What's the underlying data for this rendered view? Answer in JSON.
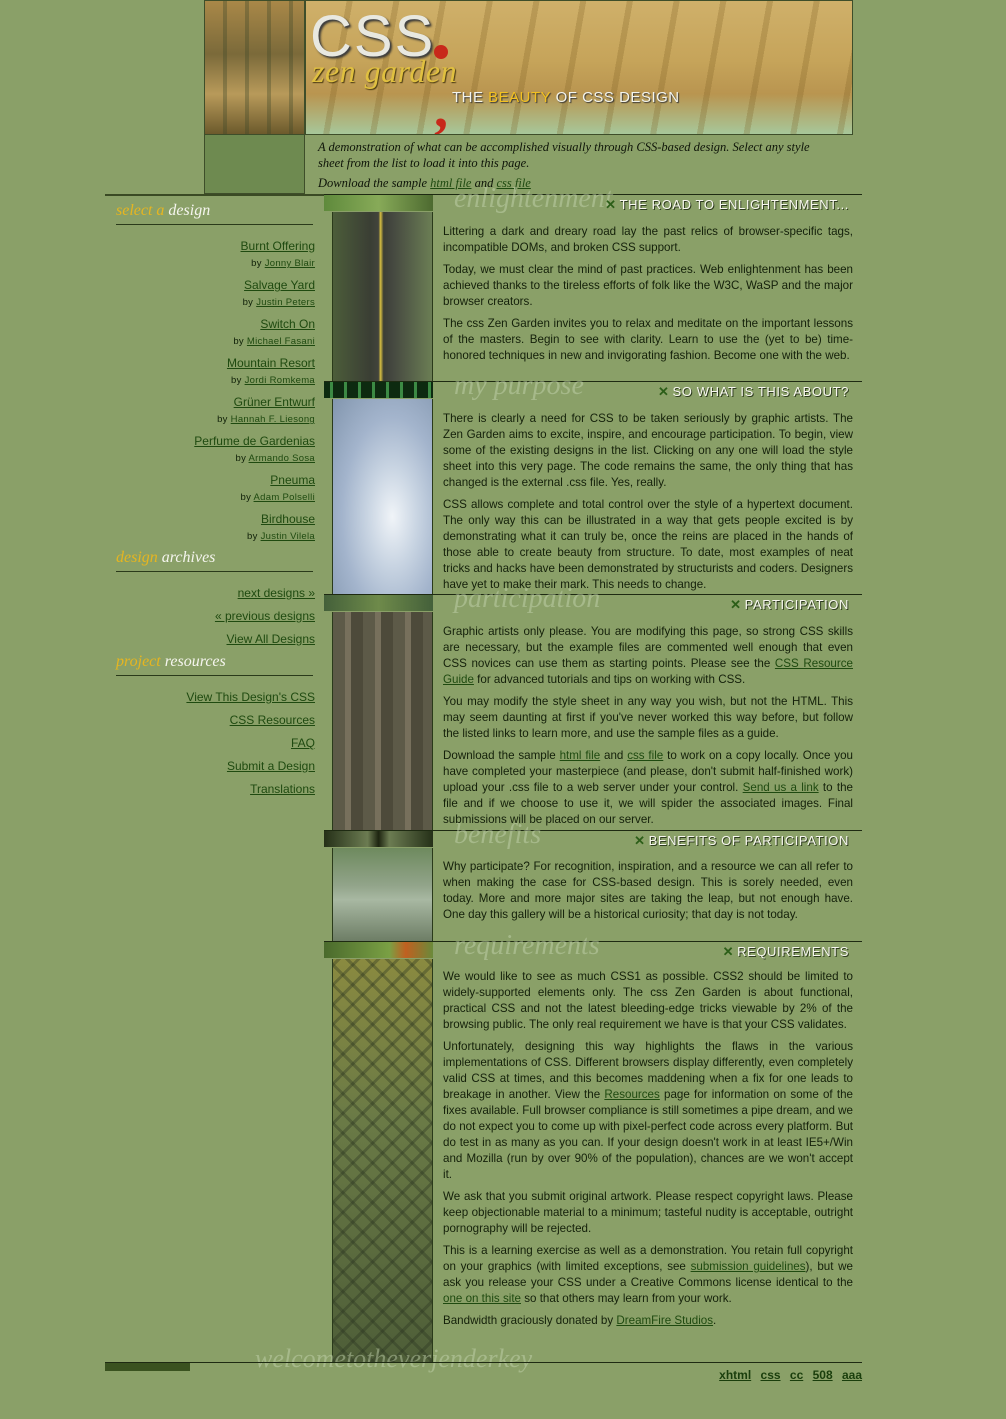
{
  "header": {
    "logo_css": "CSS",
    "logo_zen": "zen garden",
    "tagline_the": "THE",
    "tagline_beauty": "BEAUTY",
    "tagline_rest": "OF CSS DESIGN"
  },
  "intro": {
    "text": "A demonstration of what can be accomplished visually through CSS-based design. Select any style sheet from the list to load it into this page.",
    "download_prefix": "Download the sample",
    "html_file": "html file",
    "and": "and",
    "css_file": "css file"
  },
  "sidebar": {
    "select_heading": {
      "w1": "select a",
      "w2": "design"
    },
    "designs": [
      {
        "name": "Burnt Offering",
        "by": "by",
        "author": "Jonny Blair"
      },
      {
        "name": "Salvage Yard",
        "by": "by",
        "author": "Justin Peters"
      },
      {
        "name": "Switch On",
        "by": "by",
        "author": "Michael Fasani"
      },
      {
        "name": "Mountain Resort",
        "by": "by",
        "author": "Jordi Romkema"
      },
      {
        "name": "Grüner Entwurf",
        "by": "by",
        "author": "Hannah F. Liesong"
      },
      {
        "name": "Perfume de Gardenias",
        "by": "by",
        "author": "Armando Sosa"
      },
      {
        "name": "Pneuma",
        "by": "by",
        "author": "Adam Polselli"
      },
      {
        "name": "Birdhouse",
        "by": "by",
        "author": "Justin Vilela"
      }
    ],
    "archives_heading": {
      "w1": "design",
      "w2": "archives"
    },
    "archives": [
      "next designs »",
      "« previous designs",
      "View All Designs"
    ],
    "resources_heading": {
      "w1": "project",
      "w2": "resources"
    },
    "resources": [
      "View This Design's CSS",
      "CSS Resources",
      "FAQ",
      "Submit a Design",
      "Translations"
    ]
  },
  "sections": {
    "s1": {
      "ghost": "enlightenment",
      "title": "THE ROAD TO ENLIGHTENMENT...",
      "p1": "Littering a dark and dreary road lay the past relics of browser-specific tags, incompatible DOMs, and broken CSS support.",
      "p2": "Today, we must clear the mind of past practices. Web enlightenment has been achieved thanks to the tireless efforts of folk like the W3C, WaSP and the major browser creators.",
      "p3": "The css Zen Garden invites you to relax and meditate on the important lessons of the masters. Begin to see with clarity. Learn to use the (yet to be) time-honored techniques in new and invigorating fashion. Become one with the web."
    },
    "s2": {
      "ghost": "my purpose",
      "title": "SO WHAT IS THIS ABOUT?",
      "p1": "There is clearly a need for CSS to be taken seriously by graphic artists. The Zen Garden aims to excite, inspire, and encourage participation. To begin, view some of the existing designs in the list. Clicking on any one will load the style sheet into this very page. The code remains the same, the only thing that has changed is the external .css file. Yes, really.",
      "p2": "CSS allows complete and total control over the style of a hypertext document. The only way this can be illustrated in a way that gets people excited is by demonstrating what it can truly be, once the reins are placed in the hands of those able to create beauty from structure. To date, most examples of neat tricks and hacks have been demonstrated by structurists and coders. Designers have yet to make their mark. This needs to change."
    },
    "s3": {
      "ghost": "participation",
      "title": "PARTICIPATION",
      "p1_a": "Graphic artists only please. You are modifying this page, so strong CSS skills are necessary, but the example files are commented well enough that even CSS novices can use them as starting points. Please see the",
      "p1_link": "CSS Resource Guide",
      "p1_b": "for advanced tutorials and tips on working with CSS.",
      "p2": "You may modify the style sheet in any way you wish, but not the HTML. This may seem daunting at first if you've never worked this way before, but follow the listed links to learn more, and use the sample files as a guide.",
      "p3_a": "Download the sample",
      "p3_html": "html file",
      "p3_and": "and",
      "p3_css": "css file",
      "p3_b": "to work on a copy locally. Once you have completed your masterpiece (and please, don't submit half-finished work) upload your .css file to a web server under your control.",
      "p3_send": "Send us a link",
      "p3_c": "to the file and if we choose to use it, we will spider the associated images. Final submissions will be placed on our server."
    },
    "s4": {
      "ghost": "benefits",
      "title": "BENEFITS OF PARTICIPATION",
      "p1": "Why participate? For recognition, inspiration, and a resource we can all refer to when making the case for CSS-based design. This is sorely needed, even today. More and more major sites are taking the leap, but not enough have. One day this gallery will be a historical curiosity; that day is not today."
    },
    "s5": {
      "ghost": "requirements",
      "title": "REQUIREMENTS",
      "p1": "We would like to see as much CSS1 as possible. CSS2 should be limited to widely-supported elements only. The css Zen Garden is about functional, practical CSS and not the latest bleeding-edge tricks viewable by 2% of the browsing public. The only real requirement we have is that your CSS validates.",
      "p2_a": "Unfortunately, designing this way highlights the flaws in the various implementations of CSS. Different browsers display differently, even completely valid CSS at times, and this becomes maddening when a fix for one leads to breakage in another. View the",
      "p2_link": "Resources",
      "p2_b": "page for information on some of the fixes available. Full browser compliance is still sometimes a pipe dream, and we do not expect you to come up with pixel-perfect code across every platform. But do test in as many as you can. If your design doesn't work in at least IE5+/Win and Mozilla (run by over 90% of the population), chances are we won't accept it.",
      "p3": "We ask that you submit original artwork. Please respect copyright laws. Please keep objectionable material to a minimum; tasteful nudity is acceptable, outright pornography will be rejected.",
      "p4_a": "This is a learning exercise as well as a demonstration. You retain full copyright on your graphics (with limited exceptions, see",
      "p4_link1": "submission guidelines",
      "p4_b": "), but we ask you release your CSS under a Creative Commons license identical to the",
      "p4_link2": "one on this site",
      "p4_c": "so that others may learn from your work.",
      "p5_a": "Bandwidth graciously donated by",
      "p5_link": "DreamFire Studios",
      "p5_b": "."
    }
  },
  "footer": {
    "ghost": "welcometotheverjenderkey",
    "links": [
      "xhtml",
      "css",
      "cc",
      "508",
      "aaa"
    ]
  }
}
